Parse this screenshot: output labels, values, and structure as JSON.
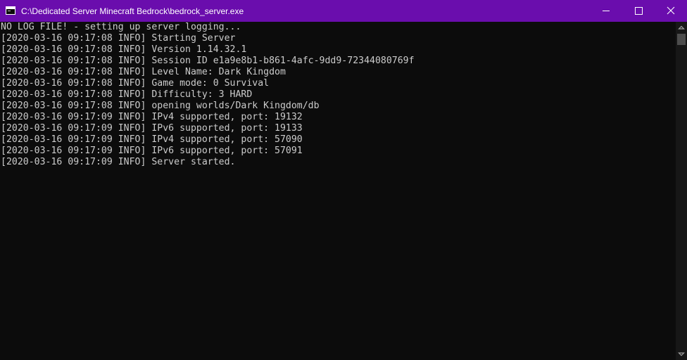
{
  "window": {
    "title": "C:\\Dedicated Server Minecraft Bedrock\\bedrock_server.exe",
    "accent_color": "#6a0dad",
    "icons": {
      "app": "console-window-icon",
      "minimize": "minimize-icon",
      "maximize": "maximize-icon",
      "close": "close-icon"
    }
  },
  "console": {
    "background": "#0c0c0c",
    "foreground": "#cccccc",
    "lines": [
      "NO LOG FILE! - setting up server logging...",
      "[2020-03-16 09:17:08 INFO] Starting Server",
      "[2020-03-16 09:17:08 INFO] Version 1.14.32.1",
      "[2020-03-16 09:17:08 INFO] Session ID e1a9e8b1-b861-4afc-9dd9-72344080769f",
      "[2020-03-16 09:17:08 INFO] Level Name: Dark Kingdom",
      "[2020-03-16 09:17:08 INFO] Game mode: 0 Survival",
      "[2020-03-16 09:17:08 INFO] Difficulty: 3 HARD",
      "[2020-03-16 09:17:08 INFO] opening worlds/Dark Kingdom/db",
      "[2020-03-16 09:17:09 INFO] IPv4 supported, port: 19132",
      "[2020-03-16 09:17:09 INFO] IPv6 supported, port: 19133",
      "[2020-03-16 09:17:09 INFO] IPv4 supported, port: 57090",
      "[2020-03-16 09:17:09 INFO] IPv6 supported, port: 57091",
      "[2020-03-16 09:17:09 INFO] Server started."
    ]
  },
  "scrollbar": {
    "up_icon": "scroll-up-arrow-icon",
    "down_icon": "scroll-down-arrow-icon"
  }
}
